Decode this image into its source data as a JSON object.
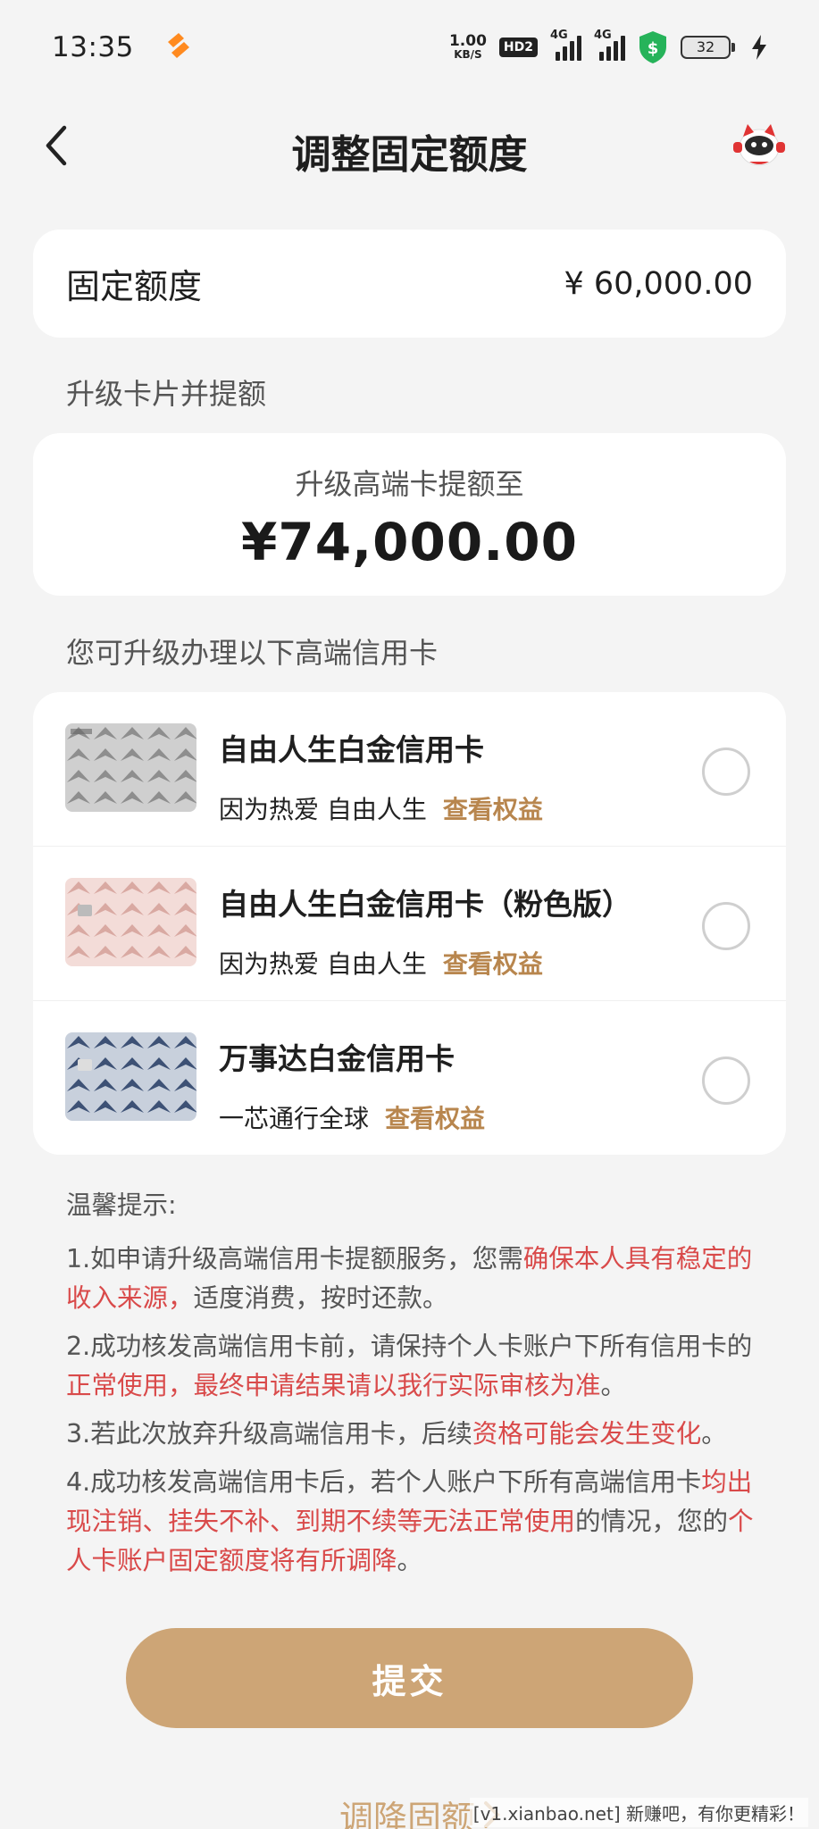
{
  "status_bar": {
    "time": "13:35",
    "net_speed_value": "1.00",
    "net_speed_unit": "KB/S",
    "hd_badge": "HD2",
    "signal_label_1": "4G",
    "signal_label_2": "4G",
    "battery_level": "32"
  },
  "nav": {
    "title": "调整固定额度",
    "back_icon": "chevron-left-icon",
    "right_icon": "mascot-icon"
  },
  "fixed_limit": {
    "label": "固定额度",
    "value": "¥ 60,000.00"
  },
  "upgrade_section": {
    "section_label": "升级卡片并提额",
    "subtitle": "升级高端卡提额至",
    "amount": "¥74,000.00"
  },
  "cards_section": {
    "section_label": "您可升级办理以下高端信用卡",
    "items": [
      {
        "name": "自由人生白金信用卡",
        "desc": "因为热爱 自由人生",
        "link": "查看权益",
        "image": "silver-card-thumbnail"
      },
      {
        "name": "自由人生白金信用卡（粉色版）",
        "desc": "因为热爱 自由人生",
        "link": "查看权益",
        "image": "pink-card-thumbnail"
      },
      {
        "name": "万事达白金信用卡",
        "desc": "一芯通行全球",
        "link": "查看权益",
        "image": "blue-card-thumbnail"
      }
    ]
  },
  "tips": {
    "title": "温馨提示:",
    "t1_a": "1.如申请升级高端信用卡提额服务，您需",
    "t1_red": "确保本人具有稳定的收入来源，",
    "t1_b": "适度消费，按时还款。",
    "t2_a": "2.成功核发高端信用卡前，请保持个人卡账户下所有信用卡的",
    "t2_red": "正常使用，最终申请结果请以我行实际审核为准",
    "t2_b": "。",
    "t3_a": "3.若此次放弃升级高端信用卡，后续",
    "t3_red": "资格可能会发生变化",
    "t3_b": "。",
    "t4_a": "4.成功核发高端信用卡后，若个人账户下所有高端信用卡",
    "t4_red": "均出现注销、挂失不补、到期不续等无法正常使用",
    "t4_b": "的情况，您的",
    "t4_red2": "个人卡账户固定额度将有所调降",
    "t4_c": "。"
  },
  "actions": {
    "submit_label": "提交",
    "bottom_link": "调降固额"
  },
  "watermark": "[v1.xianbao.net] 新赚吧，有你更精彩！",
  "colors": {
    "accent_gold": "#cda576",
    "link_gold": "#b8864e",
    "warning_red": "#d94a4a",
    "background": "#f4f4f4"
  }
}
